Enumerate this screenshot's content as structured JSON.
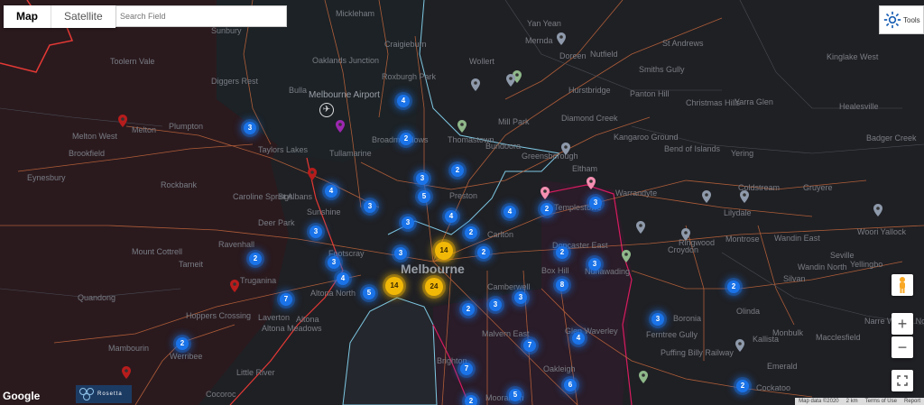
{
  "map_type_tabs": [
    {
      "label": "Map",
      "active": true
    },
    {
      "label": "Satellite",
      "active": false
    }
  ],
  "search": {
    "placeholder": "Search Field"
  },
  "tools": {
    "label": "Tools"
  },
  "city_label": "Melbourne",
  "places": [
    "Sunbury",
    "Mickleham",
    "Yan Yean",
    "Craigieburn",
    "Oaklands Junction",
    "Melbourne Airport",
    "Roxburgh Park",
    "Wollert",
    "Mernda",
    "Doreen",
    "St Andrews",
    "Nutfield",
    "Kinglake West",
    "Toolern Vale",
    "Diggers Rest",
    "Bulla",
    "Melton West",
    "Melton",
    "Brookfield",
    "Plumpton",
    "Taylors Lakes",
    "Tullamarine",
    "Broadmeadows",
    "Thomastown",
    "Mill Park",
    "Diamond Creek",
    "Hurstbridge",
    "Panton Hill",
    "Smiths Gully",
    "Christmas Hills",
    "Yarra Glen",
    "Healesville",
    "Rockbank",
    "Caroline Springs",
    "St Albans",
    "Bundoora",
    "Greensborough",
    "Eltham",
    "Kangaroo Ground",
    "Bend of Islands",
    "Yering",
    "Badger Creek",
    "Eynesbury",
    "Deer Park",
    "Ravenhall",
    "Sunshine",
    "Preston",
    "Templestowe",
    "Warrandyte",
    "Coldstream",
    "Gruyere",
    "Mount Cottrell",
    "Tarneit",
    "Truganina",
    "Footscray",
    "Carlton",
    "Doncaster East",
    "Box Hill",
    "Nunawading",
    "Croydon",
    "Lilydale",
    "Wandin North",
    "Woori Yallock",
    "Quandong",
    "Laverton",
    "Altona North",
    "Altona",
    "Altona Meadows",
    "Hoppers Crossing",
    "Camberwell",
    "Glen Waverley",
    "Malvern East",
    "Ringwood",
    "Montrose",
    "Wandin East",
    "Seville",
    "Silvan",
    "Olinda",
    "Yellingbo",
    "Boronia",
    "Ferntree Gully",
    "Monbulk",
    "Kallista",
    "Macclesfield",
    "Mambourin",
    "Werribee",
    "Little River",
    "Cocoroc",
    "Brighton",
    "Oakleigh",
    "Moorabbin",
    "Puffing Billy Railway",
    "Emerald",
    "Cockatoo",
    "Narre Warren North"
  ],
  "clusters": [
    {
      "count": "4",
      "color": "#1a73e8"
    },
    {
      "count": "2",
      "color": "#1a73e8"
    },
    {
      "count": "3",
      "color": "#1a73e8"
    },
    {
      "count": "2",
      "color": "#1a73e8"
    },
    {
      "count": "5",
      "color": "#1a73e8"
    },
    {
      "count": "4",
      "color": "#1a73e8"
    },
    {
      "count": "3",
      "color": "#1a73e8"
    },
    {
      "count": "3",
      "color": "#1a73e8"
    },
    {
      "count": "4",
      "color": "#1a73e8"
    },
    {
      "count": "2",
      "color": "#1a73e8"
    },
    {
      "count": "4",
      "color": "#1a73e8"
    },
    {
      "count": "3",
      "color": "#1a73e8"
    },
    {
      "count": "2",
      "color": "#1a73e8"
    },
    {
      "count": "3",
      "color": "#1a73e8"
    },
    {
      "count": "4",
      "color": "#1a73e8"
    },
    {
      "count": "5",
      "color": "#1a73e8"
    },
    {
      "count": "14",
      "color": "#f2b807"
    },
    {
      "count": "24",
      "color": "#f2b807"
    },
    {
      "count": "14",
      "color": "#f2b807"
    },
    {
      "count": "7",
      "color": "#1a73e8"
    },
    {
      "count": "2",
      "color": "#1a73e8"
    },
    {
      "count": "3",
      "color": "#1a73e8"
    },
    {
      "count": "2",
      "color": "#1a73e8"
    },
    {
      "count": "8",
      "color": "#1a73e8"
    },
    {
      "count": "2",
      "color": "#1a73e8"
    },
    {
      "count": "3",
      "color": "#1a73e8"
    },
    {
      "count": "3",
      "color": "#1a73e8"
    },
    {
      "count": "7",
      "color": "#1a73e8"
    },
    {
      "count": "4",
      "color": "#1a73e8"
    },
    {
      "count": "3",
      "color": "#1a73e8"
    },
    {
      "count": "2",
      "color": "#1a73e8"
    },
    {
      "count": "7",
      "color": "#1a73e8"
    },
    {
      "count": "5",
      "color": "#1a73e8"
    },
    {
      "count": "2",
      "color": "#1a73e8"
    },
    {
      "count": "6",
      "color": "#1a73e8"
    },
    {
      "count": "2",
      "color": "#1a73e8"
    },
    {
      "count": "2",
      "color": "#1a73e8"
    },
    {
      "count": "3",
      "color": "#1a73e8"
    },
    {
      "count": "3",
      "color": "#1a73e8"
    },
    {
      "count": "3",
      "color": "#1a73e8"
    },
    {
      "count": "2",
      "color": "#1a73e8"
    }
  ],
  "pins": [
    {
      "icon": "map-pin-icon",
      "color": "#8e9aab"
    },
    {
      "icon": "map-pin-icon",
      "color": "#8e9aab"
    },
    {
      "icon": "map-pin-icon",
      "color": "#8fb88a"
    },
    {
      "icon": "map-pin-icon",
      "color": "#8e9aab"
    },
    {
      "icon": "map-pin-icon",
      "color": "#8fb88a"
    },
    {
      "icon": "map-pin-icon",
      "color": "#8e9aab"
    },
    {
      "icon": "map-pin-icon",
      "color": "#f48fb1"
    },
    {
      "icon": "map-pin-icon",
      "color": "#f48fb1"
    },
    {
      "icon": "map-pin-icon",
      "color": "#8e9aab"
    },
    {
      "icon": "map-pin-icon",
      "color": "#8e9aab"
    },
    {
      "icon": "map-pin-icon",
      "color": "#8e9aab"
    },
    {
      "icon": "map-pin-icon",
      "color": "#8e9aab"
    },
    {
      "icon": "map-pin-icon",
      "color": "#8e9aab"
    },
    {
      "icon": "map-pin-icon",
      "color": "#8fb88a"
    },
    {
      "icon": "map-pin-icon",
      "color": "#8fb88a"
    },
    {
      "icon": "map-pin-icon",
      "color": "#b71c1c"
    },
    {
      "icon": "map-pin-icon",
      "color": "#b71c1c"
    },
    {
      "icon": "map-pin-icon",
      "color": "#b71c1c"
    },
    {
      "icon": "map-pin-icon",
      "color": "#b71c1c"
    },
    {
      "icon": "map-pin-icon",
      "color": "#9c27b0"
    },
    {
      "icon": "map-pin-icon",
      "color": "#8e9aab"
    }
  ],
  "zoom": {
    "in": "+",
    "out": "−"
  },
  "logo": "Google",
  "rosetta": "Rosetta",
  "attribution": [
    "Map data ©2020",
    "2 km",
    "Terms of Use",
    "Report"
  ]
}
